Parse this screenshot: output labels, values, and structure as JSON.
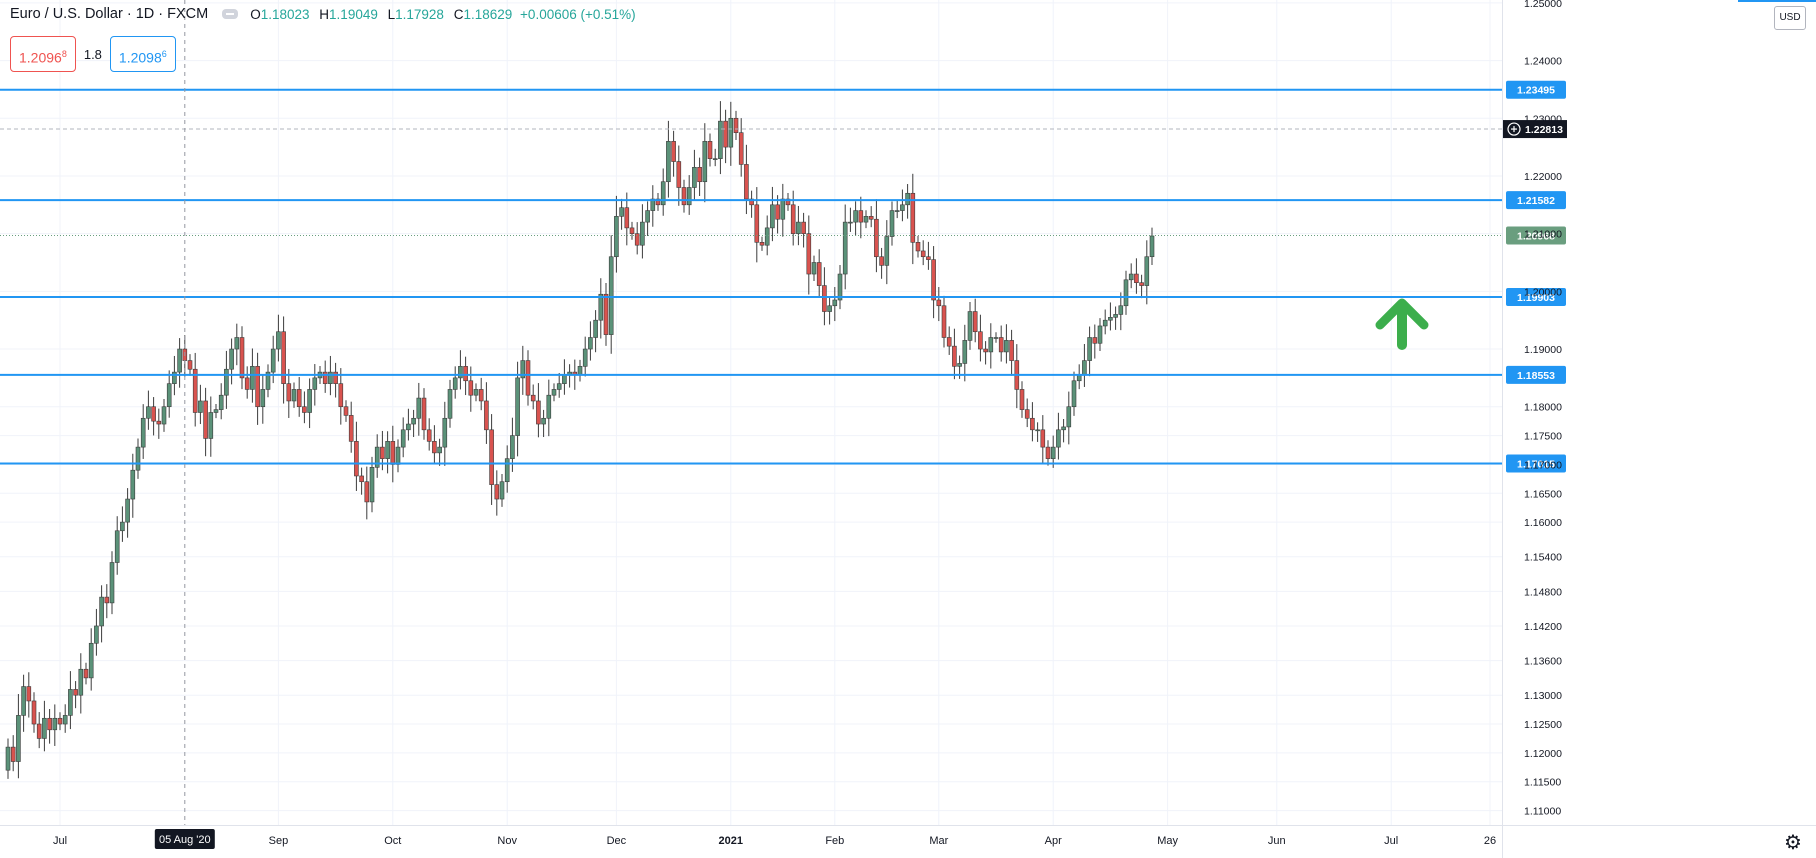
{
  "legend": {
    "title": "Euro / U.S. Dollar · 1D · FXCM",
    "open_label": "O",
    "open": "1.18023",
    "high_label": "H",
    "high": "1.19049",
    "low_label": "L",
    "low": "1.17928",
    "close_label": "C",
    "close": "1.18629",
    "change": "+0.00606 (+0.51%)"
  },
  "trade": {
    "sell_price": "1.2096",
    "sell_pip": "8",
    "spread": "1.8",
    "buy_price": "1.2098",
    "buy_pip": "6"
  },
  "currency_badge": "USD",
  "colors": {
    "up": "#5b9279",
    "down": "#d9534f",
    "level_line": "#2196f3",
    "last_price": "#6a9e7f",
    "arrow": "#3cae4c"
  },
  "chart_data": {
    "type": "candlestick",
    "y_range": [
      1.1075,
      1.2505
    ],
    "y_ticks": [
      "1.25000",
      "1.24000",
      "1.23000",
      "1.22000",
      "1.21000",
      "1.20000",
      "1.19000",
      "1.18000",
      "1.17500",
      "1.17000",
      "1.16500",
      "1.16000",
      "1.15400",
      "1.14800",
      "1.14200",
      "1.13600",
      "1.13000",
      "1.12500",
      "1.12000",
      "1.11500",
      "1.11000"
    ],
    "x_labels": [
      {
        "label": "Jul",
        "index": 10
      },
      {
        "label": "Sep",
        "index": 52
      },
      {
        "label": "Oct",
        "index": 74
      },
      {
        "label": "Nov",
        "index": 96
      },
      {
        "label": "Dec",
        "index": 117
      },
      {
        "label": "2021",
        "index": 139
      },
      {
        "label": "Feb",
        "index": 159
      },
      {
        "label": "Mar",
        "index": 179
      },
      {
        "label": "Apr",
        "index": 201
      },
      {
        "label": "May",
        "index": 223
      },
      {
        "label": "Jun",
        "index": 244
      },
      {
        "label": "Jul",
        "index": 266
      },
      {
        "label": "26",
        "index": 285
      }
    ],
    "crosshair": {
      "label": "05 Aug '20",
      "index": 34
    },
    "horizontal_levels": [
      "1.23495",
      "1.21582",
      "1.19903",
      "1.18553",
      "1.17015"
    ],
    "current_price_line": "1.22813",
    "last_price": "1.20968",
    "annotation": "up-arrow",
    "closes": [
      1.121,
      1.1185,
      1.1265,
      1.1315,
      1.129,
      1.125,
      1.1225,
      1.126,
      1.124,
      1.126,
      1.125,
      1.1265,
      1.131,
      1.13,
      1.1345,
      1.133,
      1.139,
      1.142,
      1.147,
      1.146,
      1.153,
      1.1585,
      1.16,
      1.164,
      1.169,
      1.173,
      1.178,
      1.18,
      1.1775,
      1.177,
      1.18,
      1.184,
      1.186,
      1.19,
      1.188,
      1.1865,
      1.179,
      1.181,
      1.1745,
      1.179,
      1.1795,
      1.182,
      1.1865,
      1.19,
      1.192,
      1.185,
      1.183,
      1.187,
      1.18,
      1.183,
      1.186,
      1.19,
      1.193,
      1.184,
      1.181,
      1.183,
      1.18,
      1.179,
      1.183,
      1.185,
      1.186,
      1.184,
      1.186,
      1.184,
      1.18,
      1.1785,
      1.174,
      1.168,
      1.167,
      1.1635,
      1.1695,
      1.173,
      1.171,
      1.174,
      1.17,
      1.173,
      1.176,
      1.177,
      1.178,
      1.1815,
      1.176,
      1.174,
      1.172,
      1.173,
      1.178,
      1.183,
      1.185,
      1.187,
      1.1845,
      1.182,
      1.183,
      1.181,
      1.176,
      1.1665,
      1.164,
      1.167,
      1.171,
      1.175,
      1.185,
      1.188,
      1.182,
      1.181,
      1.177,
      1.178,
      1.182,
      1.183,
      1.184,
      1.1855,
      1.186,
      1.1855,
      1.187,
      1.19,
      1.192,
      1.195,
      1.1995,
      1.1925,
      1.206,
      1.213,
      1.2145,
      1.211,
      1.21,
      1.208,
      1.212,
      1.214,
      1.216,
      1.215,
      1.219,
      1.226,
      1.2225,
      1.218,
      1.215,
      1.218,
      1.2215,
      1.219,
      1.226,
      1.223,
      1.223,
      1.2295,
      1.225,
      1.23,
      1.2275,
      1.222,
      1.216,
      1.215,
      1.2085,
      1.208,
      1.211,
      1.215,
      1.2125,
      1.216,
      1.215,
      1.21,
      1.212,
      1.21,
      1.203,
      1.205,
      1.201,
      1.1965,
      1.1975,
      1.1985,
      1.203,
      1.212,
      1.212,
      1.214,
      1.212,
      1.213,
      1.2125,
      1.206,
      1.2045,
      1.2095,
      1.214,
      1.214,
      1.215,
      1.217,
      1.2085,
      1.207,
      1.206,
      1.2055,
      1.1985,
      1.1975,
      1.192,
      1.1905,
      1.187,
      1.1875,
      1.1915,
      1.1965,
      1.193,
      1.19,
      1.1895,
      1.192,
      1.192,
      1.1895,
      1.1915,
      1.188,
      1.183,
      1.1795,
      1.178,
      1.176,
      1.176,
      1.173,
      1.171,
      1.173,
      1.176,
      1.1765,
      1.18,
      1.1845,
      1.1855,
      1.188,
      1.192,
      1.191,
      1.194,
      1.195,
      1.1955,
      1.196,
      1.1975,
      1.202,
      1.203,
      1.2015,
      1.201,
      1.206,
      1.2096
    ]
  }
}
